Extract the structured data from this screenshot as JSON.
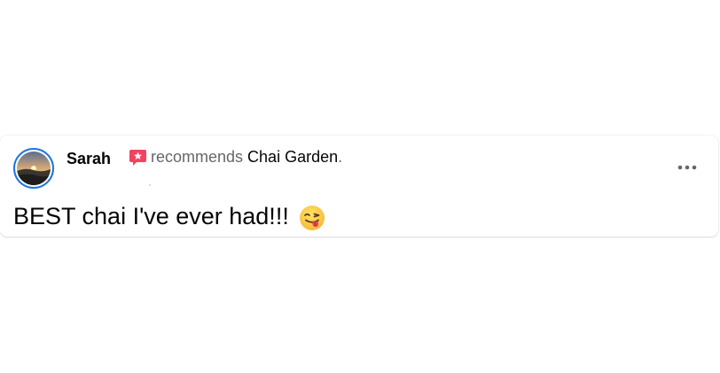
{
  "post": {
    "author_name": "Sarah",
    "recommend_verb": "recommends",
    "page_name": "Chai Garden",
    "period": ".",
    "text": "BEST chai I've ever had!!!",
    "emoji_icon": "face-savoring-food-emoji",
    "recommend_icon": "recommend-star-icon",
    "more_icon": "more-options-icon"
  },
  "colors": {
    "text_primary": "#050505",
    "text_secondary": "#65676b",
    "avatar_ring": "#1b74e4",
    "recommend_badge": "#f3425f"
  }
}
